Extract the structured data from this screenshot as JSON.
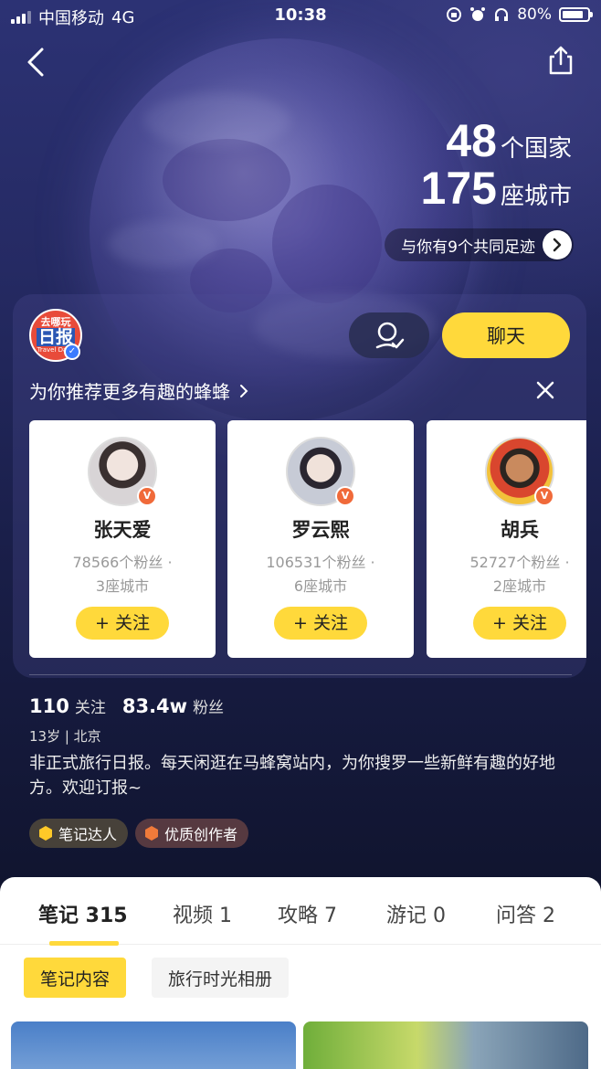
{
  "status_bar": {
    "carrier": "中国移动",
    "network": "4G",
    "time": "10:38",
    "battery": "80%"
  },
  "header": {
    "countries_num": "48",
    "countries_unit": "个国家",
    "cities_num": "175",
    "cities_unit": "座城市",
    "common_footprint": "与你有9个共同足迹"
  },
  "profile": {
    "avatar_text_top": "去哪玩",
    "avatar_text_main": "日报",
    "avatar_text_sub": "Travel Daily",
    "chat_label": "聊天",
    "following_count": "110",
    "following_label": "关注",
    "fans_count": "83.4w",
    "fans_label": "粉丝",
    "age_location": "13岁 | 北京",
    "bio": "非正式旅行日报。每天闲逛在马蜂窝站内，为你搜罗一些新鲜有趣的好地方。欢迎订报~",
    "badges": [
      "笔记达人",
      "优质创作者"
    ]
  },
  "recommend": {
    "title": "为你推荐更多有趣的蜂蜂",
    "cards": [
      {
        "name": "张天爱",
        "fans": "78566个粉丝",
        "cities": "3座城市",
        "follow": "+ 关注"
      },
      {
        "name": "罗云熙",
        "fans": "106531个粉丝",
        "cities": "6座城市",
        "follow": "+ 关注"
      },
      {
        "name": "胡兵",
        "fans": "52727个粉丝",
        "cities": "2座城市",
        "follow": "+ 关注"
      }
    ]
  },
  "tabs": [
    {
      "label": "笔记 315"
    },
    {
      "label": "视频 1"
    },
    {
      "label": "攻略 7"
    },
    {
      "label": "游记 0"
    },
    {
      "label": "问答 2"
    }
  ],
  "subtabs": [
    "笔记内容",
    "旅行时光相册"
  ],
  "colors": {
    "accent_yellow": "#ffd93b",
    "background_dark": "#1a1f4a"
  }
}
